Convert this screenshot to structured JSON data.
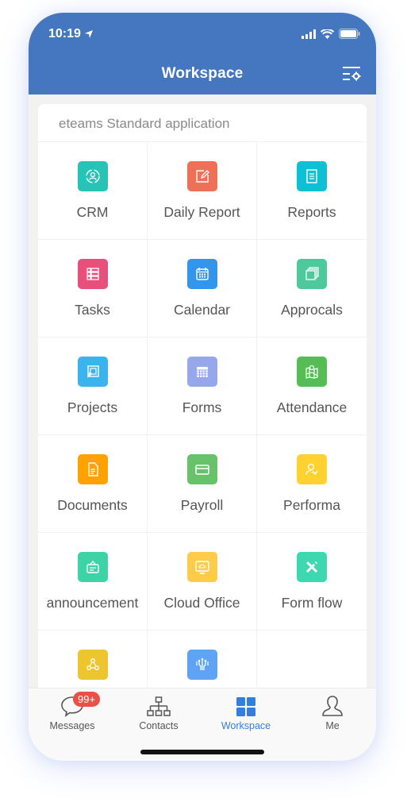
{
  "status_bar": {
    "time": "10:19"
  },
  "header": {
    "title": "Workspace",
    "settings_icon": "list-settings-icon"
  },
  "section": {
    "title": "eteams Standard application"
  },
  "apps": [
    {
      "label": "CRM",
      "icon": "crm-icon",
      "color": "#26c3b6"
    },
    {
      "label": "Daily Report",
      "icon": "daily-report-icon",
      "color": "#ef7057"
    },
    {
      "label": "Reports",
      "icon": "reports-icon",
      "color": "#0fbfd4"
    },
    {
      "label": "Tasks",
      "icon": "tasks-icon",
      "color": "#e8507c"
    },
    {
      "label": "Calendar",
      "icon": "calendar-icon",
      "color": "#3295ee"
    },
    {
      "label": "Approcals",
      "icon": "approvals-icon",
      "color": "#4ec99e"
    },
    {
      "label": "Projects",
      "icon": "projects-icon",
      "color": "#39b4ef"
    },
    {
      "label": "Forms",
      "icon": "forms-icon",
      "color": "#97a7ec"
    },
    {
      "label": "Attendance",
      "icon": "attendance-icon",
      "color": "#56bd54"
    },
    {
      "label": "Documents",
      "icon": "documents-icon",
      "color": "#ffa200"
    },
    {
      "label": "Payroll",
      "icon": "payroll-icon",
      "color": "#67c26a"
    },
    {
      "label": "Performa",
      "icon": "performance-icon",
      "color": "#ffd230"
    },
    {
      "label": "announcement",
      "icon": "announcement-icon",
      "color": "#3ed3a6"
    },
    {
      "label": "Cloud Office",
      "icon": "cloud-office-icon",
      "color": "#ffcb4a"
    },
    {
      "label": "Form flow",
      "icon": "form-flow-icon",
      "color": "#3dd8b0"
    },
    {
      "label": "",
      "icon": "network-icon",
      "color": "#ecc52f"
    },
    {
      "label": "",
      "icon": "flow-icon",
      "color": "#5fa3f7"
    },
    {
      "label": "",
      "icon": "",
      "color": ""
    }
  ],
  "tabbar": {
    "tabs": [
      {
        "label": "Messages",
        "icon": "chat-bubble-icon",
        "badge": "99+"
      },
      {
        "label": "Contacts",
        "icon": "org-chart-icon"
      },
      {
        "label": "Workspace",
        "icon": "grid-icon",
        "active": true
      },
      {
        "label": "Me",
        "icon": "person-icon"
      }
    ]
  },
  "colors": {
    "header": "#4577c0",
    "active_tab": "#2f7ee0",
    "badge": "#ea5046"
  }
}
